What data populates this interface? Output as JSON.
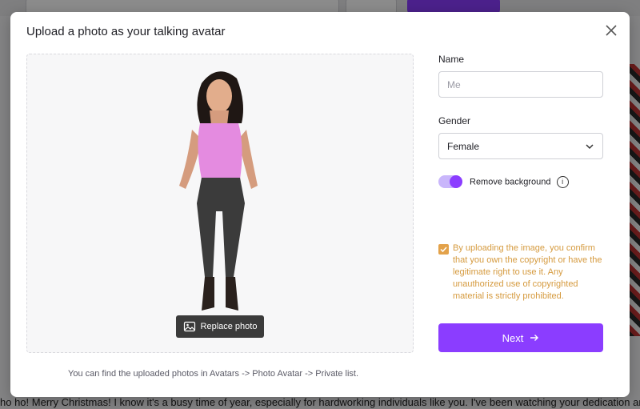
{
  "background": {
    "bottom_text": "ho ho! Merry Christmas! I know it's a busy time of year, especially for hardworking individuals like you. I've been watching your dedication and effort"
  },
  "modal": {
    "title": "Upload a photo as your talking avatar",
    "close_icon": "close-icon",
    "replace_photo_label": "Replace photo",
    "info_note": "You can find the uploaded photos in Avatars -> Photo Avatar -> Private list."
  },
  "form": {
    "name_label": "Name",
    "name_placeholder": "Me",
    "name_value": "",
    "gender_label": "Gender",
    "gender_value": "Female",
    "remove_bg_label": "Remove background",
    "remove_bg_enabled": true,
    "consent_text": "By uploading the image, you confirm that you own the copyright or have the legitimate right to use it. Any unauthorized use of copyrighted material is strictly prohibited.",
    "consent_checked": true,
    "next_label": "Next"
  },
  "colors": {
    "accent": "#8b3dff",
    "toggle_track": "#c9b6fb",
    "consent": "#d59a3e"
  }
}
